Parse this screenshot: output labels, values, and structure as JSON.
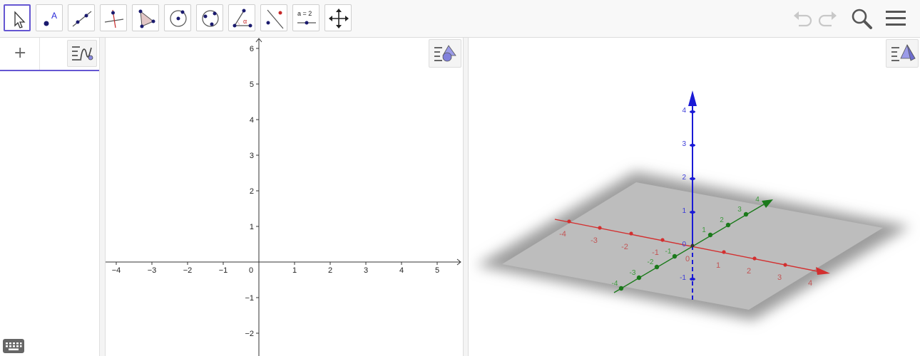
{
  "toolbar": {
    "tools": [
      {
        "id": "move",
        "icon": "cursor-arrow-icon",
        "selected": true
      },
      {
        "id": "point",
        "icon": "point-icon",
        "label": "A"
      },
      {
        "id": "line",
        "icon": "line-through-points-icon"
      },
      {
        "id": "perpendicular",
        "icon": "perpendicular-line-icon"
      },
      {
        "id": "polygon",
        "icon": "polygon-icon"
      },
      {
        "id": "circle",
        "icon": "circle-center-point-icon"
      },
      {
        "id": "circle3",
        "icon": "circle-three-points-icon"
      },
      {
        "id": "angle",
        "icon": "angle-icon",
        "label": "α"
      },
      {
        "id": "reflect",
        "icon": "reflect-about-line-icon"
      },
      {
        "id": "slider",
        "icon": "slider-icon",
        "label": "a = 2"
      },
      {
        "id": "move-view",
        "icon": "move-graphics-view-icon"
      }
    ],
    "right": [
      "undo-icon",
      "redo-icon",
      "search-icon",
      "menu-icon"
    ]
  },
  "algebra": {
    "plus": "+",
    "style_icon": "algebra-style-icon"
  },
  "graphics2d": {
    "x_ticks": [
      "−4",
      "−3",
      "−2",
      "−1",
      "1",
      "2",
      "3",
      "4",
      "5"
    ],
    "y_ticks": [
      "6",
      "5",
      "4",
      "3",
      "2",
      "1",
      "−1",
      "−2"
    ],
    "origin": "0",
    "style_icon": "graphics-style-icon"
  },
  "graphics3d": {
    "z_ticks": [
      "4",
      "3",
      "2",
      "1",
      "-1"
    ],
    "x_ticks_neg": [
      "-4",
      "-3",
      "-2",
      "-1"
    ],
    "x_ticks_pos": [
      "1",
      "2",
      "3",
      "4"
    ],
    "y_ticks_neg": [
      "-4",
      "-3",
      "-2",
      "-1"
    ],
    "y_ticks_pos": [
      "1",
      "2",
      "3",
      "4"
    ],
    "origin_z": "0",
    "origin_x": "0",
    "style_icon": "3d-style-icon",
    "colors": {
      "x": "#d32f2f",
      "y": "#1b7a1b",
      "z": "#1a1ad6"
    }
  }
}
